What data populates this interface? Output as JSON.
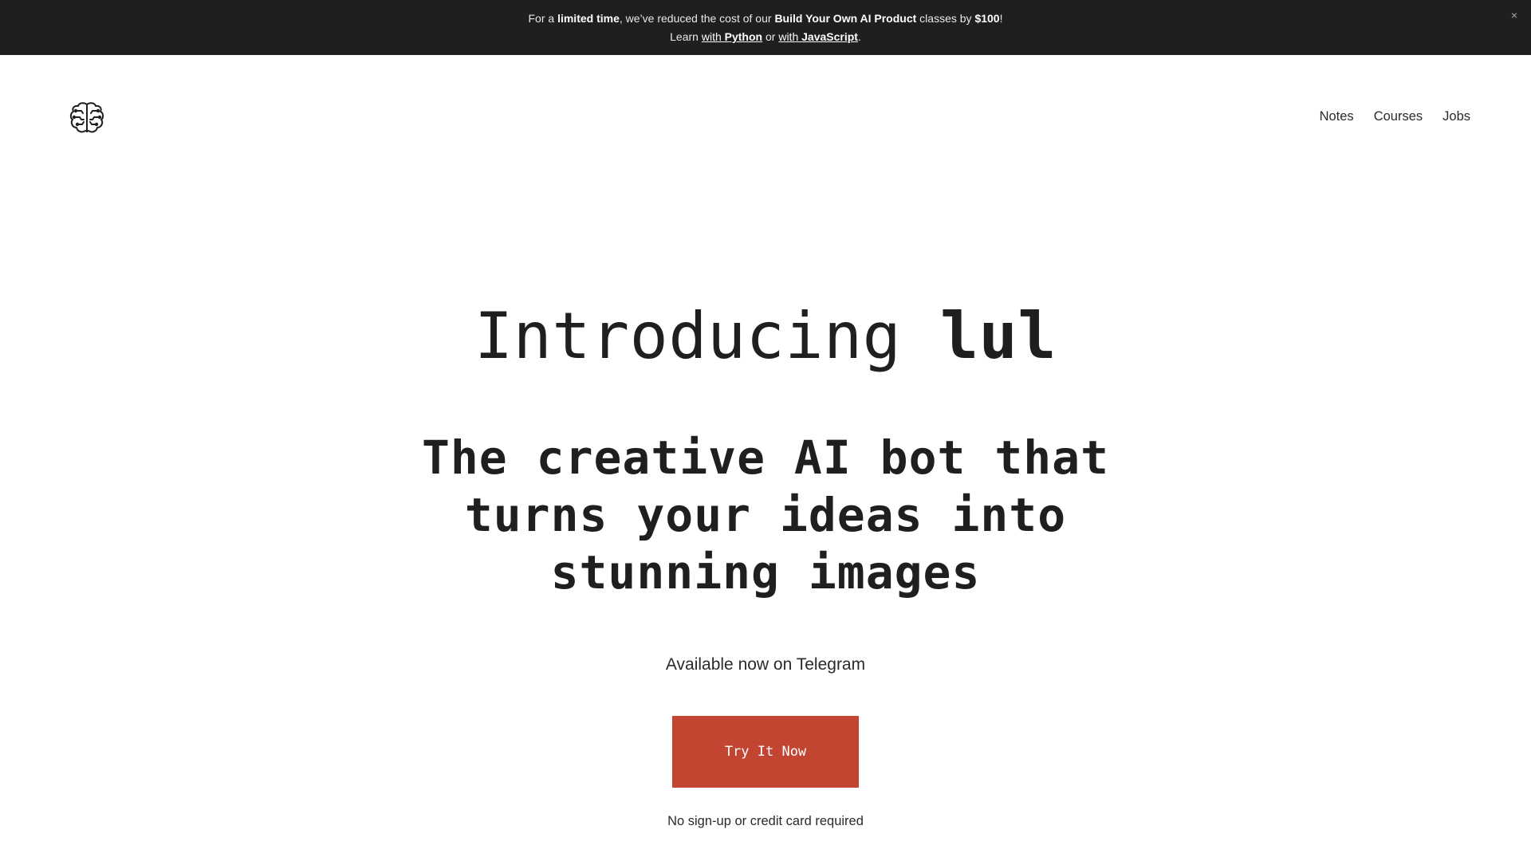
{
  "banner": {
    "line1_prefix": "For a ",
    "line1_highlight1": "limited time",
    "line1_mid": ", we’ve reduced the cost of our ",
    "line1_highlight2": "Build Your Own AI Product",
    "line1_mid2": " classes by ",
    "line1_highlight3": "$100",
    "line1_suffix": "!",
    "line2_prefix": "Learn ",
    "link_python_with": "with ",
    "link_python_name": "Python",
    "line2_or": " or ",
    "link_js_with": "with ",
    "link_js_name": "JavaScript",
    "line2_suffix": ".",
    "close_label": "×"
  },
  "header": {
    "logo_icon": "brain-icon",
    "nav": [
      "Notes",
      "Courses",
      "Jobs"
    ]
  },
  "hero": {
    "title_prefix": "Introducing ",
    "title_product": "lul",
    "subtitle_line1": "The creative AI bot that",
    "subtitle_line2": "turns your ideas into",
    "subtitle_line3": "stunning images",
    "availability": "Available now on Telegram",
    "cta_label": "Try It Now",
    "fineprint": "No sign-up or credit card required"
  },
  "colors": {
    "banner_bg": "#1f1f1f",
    "cta_bg": "#c24532",
    "text": "#1f1f1f"
  }
}
